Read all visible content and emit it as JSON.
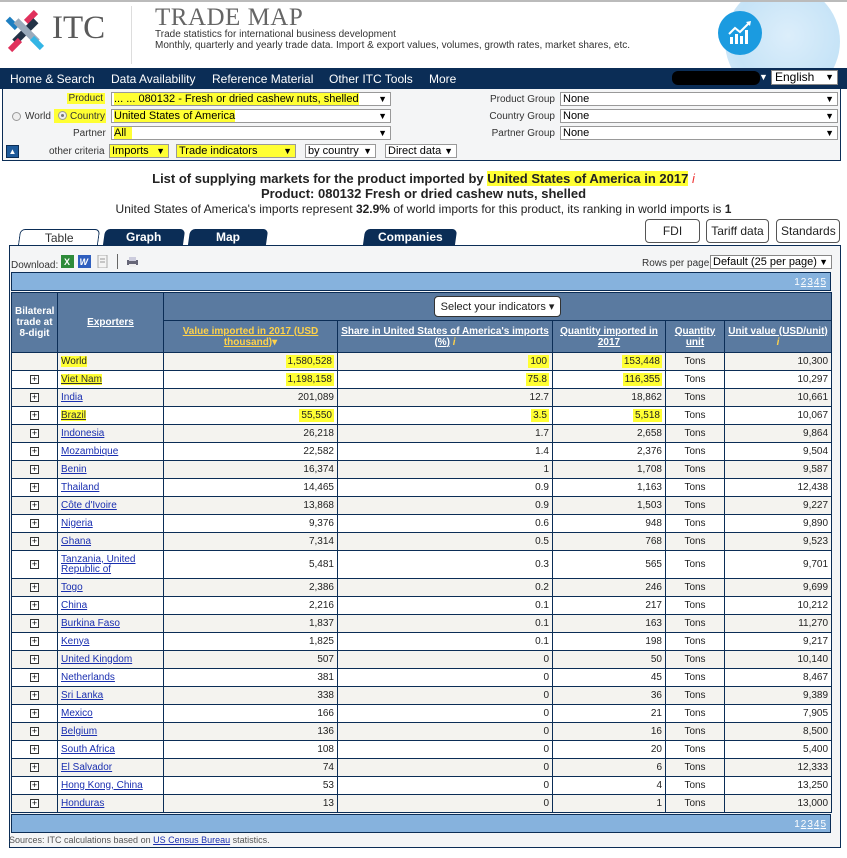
{
  "header": {
    "logo_text": "ITC",
    "title": "TRADE MAP",
    "subtitle1": "Trade statistics for international business development",
    "subtitle2": "Monthly, quarterly and yearly trade data. Import & export values, volumes, growth rates, market shares, etc.",
    "badge_icon": "trending-chart-icon"
  },
  "nav": {
    "items": [
      "Home & Search",
      "Data Availability",
      "Reference Material",
      "Other ITC Tools",
      "More"
    ],
    "language": "English"
  },
  "criteria": {
    "product_label": "Product",
    "product_value": "... ... 080132 - Fresh or dried cashew nuts, shelled",
    "world_label": "World",
    "country_label": "Country",
    "country_value": "United States of America",
    "partner_label": "Partner",
    "partner_value": "All",
    "other_label": "other criteria",
    "trade_flow": "Imports",
    "indicators": "Trade indicators",
    "by": "by country",
    "data_type": "Direct data",
    "product_group_label": "Product Group",
    "product_group_value": "None",
    "country_group_label": "Country Group",
    "country_group_value": "None",
    "partner_group_label": "Partner Group",
    "partner_group_value": "None"
  },
  "titles": {
    "line1_prefix": "List of supplying markets for the product imported by ",
    "line1_highlight": "United States of America in 2017",
    "info": "i",
    "line2": "Product: 080132 Fresh or dried cashew nuts, shelled",
    "line3_prefix": "United States of America's imports represent ",
    "line3_pct": "32.9%",
    "line3_mid": " of world imports for this product, its ranking in world imports is ",
    "line3_rank": "1"
  },
  "tabs": [
    "Table",
    "Graph",
    "Map",
    "Companies"
  ],
  "side_buttons": [
    "FDI data",
    "Tariff data",
    "Standards"
  ],
  "toolbar": {
    "download_label": "Download:",
    "rows_label": "Rows per page",
    "rows_value": "Default (25 per page)"
  },
  "pager": [
    "1",
    "2",
    "3",
    "4",
    "5"
  ],
  "table": {
    "headers": {
      "bilateral": "Bilateral trade at 8-digit",
      "exporters": "Exporters",
      "select_indicators": "Select your indicators",
      "value": "Value imported in 2017 (USD thousand)",
      "share": "Share in United States of America's imports (%)",
      "quantity": "Quantity imported in 2017",
      "unit": "Quantity unit",
      "unit_value": "Unit value (USD/unit)"
    },
    "rows": [
      {
        "exporter": "World",
        "value": "1,580,528",
        "share": "100",
        "quantity": "153,448",
        "unit": "Tons",
        "unit_value": "10,300"
      },
      {
        "exporter": "Viet Nam",
        "value": "1,198,158",
        "share": "75.8",
        "quantity": "116,355",
        "unit": "Tons",
        "unit_value": "10,297"
      },
      {
        "exporter": "India",
        "value": "201,089",
        "share": "12.7",
        "quantity": "18,862",
        "unit": "Tons",
        "unit_value": "10,661"
      },
      {
        "exporter": "Brazil",
        "value": "55,550",
        "share": "3.5",
        "quantity": "5,518",
        "unit": "Tons",
        "unit_value": "10,067"
      },
      {
        "exporter": "Indonesia",
        "value": "26,218",
        "share": "1.7",
        "quantity": "2,658",
        "unit": "Tons",
        "unit_value": "9,864"
      },
      {
        "exporter": "Mozambique",
        "value": "22,582",
        "share": "1.4",
        "quantity": "2,376",
        "unit": "Tons",
        "unit_value": "9,504"
      },
      {
        "exporter": "Benin",
        "value": "16,374",
        "share": "1",
        "quantity": "1,708",
        "unit": "Tons",
        "unit_value": "9,587"
      },
      {
        "exporter": "Thailand",
        "value": "14,465",
        "share": "0.9",
        "quantity": "1,163",
        "unit": "Tons",
        "unit_value": "12,438"
      },
      {
        "exporter": "Côte d'Ivoire",
        "value": "13,868",
        "share": "0.9",
        "quantity": "1,503",
        "unit": "Tons",
        "unit_value": "9,227"
      },
      {
        "exporter": "Nigeria",
        "value": "9,376",
        "share": "0.6",
        "quantity": "948",
        "unit": "Tons",
        "unit_value": "9,890"
      },
      {
        "exporter": "Ghana",
        "value": "7,314",
        "share": "0.5",
        "quantity": "768",
        "unit": "Tons",
        "unit_value": "9,523"
      },
      {
        "exporter": "Tanzania, United Republic of",
        "value": "5,481",
        "share": "0.3",
        "quantity": "565",
        "unit": "Tons",
        "unit_value": "9,701"
      },
      {
        "exporter": "Togo",
        "value": "2,386",
        "share": "0.2",
        "quantity": "246",
        "unit": "Tons",
        "unit_value": "9,699"
      },
      {
        "exporter": "China",
        "value": "2,216",
        "share": "0.1",
        "quantity": "217",
        "unit": "Tons",
        "unit_value": "10,212"
      },
      {
        "exporter": "Burkina Faso",
        "value": "1,837",
        "share": "0.1",
        "quantity": "163",
        "unit": "Tons",
        "unit_value": "11,270"
      },
      {
        "exporter": "Kenya",
        "value": "1,825",
        "share": "0.1",
        "quantity": "198",
        "unit": "Tons",
        "unit_value": "9,217"
      },
      {
        "exporter": "United Kingdom",
        "value": "507",
        "share": "0",
        "quantity": "50",
        "unit": "Tons",
        "unit_value": "10,140"
      },
      {
        "exporter": "Netherlands",
        "value": "381",
        "share": "0",
        "quantity": "45",
        "unit": "Tons",
        "unit_value": "8,467"
      },
      {
        "exporter": "Sri Lanka",
        "value": "338",
        "share": "0",
        "quantity": "36",
        "unit": "Tons",
        "unit_value": "9,389"
      },
      {
        "exporter": "Mexico",
        "value": "166",
        "share": "0",
        "quantity": "21",
        "unit": "Tons",
        "unit_value": "7,905"
      },
      {
        "exporter": "Belgium",
        "value": "136",
        "share": "0",
        "quantity": "16",
        "unit": "Tons",
        "unit_value": "8,500"
      },
      {
        "exporter": "South Africa",
        "value": "108",
        "share": "0",
        "quantity": "20",
        "unit": "Tons",
        "unit_value": "5,400"
      },
      {
        "exporter": "El Salvador",
        "value": "74",
        "share": "0",
        "quantity": "6",
        "unit": "Tons",
        "unit_value": "12,333"
      },
      {
        "exporter": "Hong Kong, China",
        "value": "53",
        "share": "0",
        "quantity": "4",
        "unit": "Tons",
        "unit_value": "13,250"
      },
      {
        "exporter": "Honduras",
        "value": "13",
        "share": "0",
        "quantity": "1",
        "unit": "Tons",
        "unit_value": "13,000"
      }
    ],
    "highlighted_rows": [
      "World",
      "Viet Nam",
      "Brazil"
    ]
  },
  "footer": {
    "prefix": "Sources: ITC calculations based on ",
    "link": "US Census Bureau",
    "suffix": " statistics."
  },
  "colors": {
    "nav_bg": "#0b2d56",
    "header_row": "#5a7aa0",
    "pager_bar": "#86b2dd",
    "highlight": "#ffff33",
    "header_link": "#ffd24a",
    "badge": "#1b9be0"
  }
}
